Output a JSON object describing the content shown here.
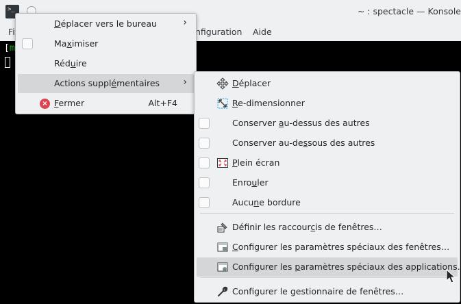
{
  "window": {
    "title": "~ : spectacle — Konsole",
    "menubar": [
      "Fi",
      "nfiguration",
      "Aide"
    ]
  },
  "terminal": {
    "prompt_bracket": "[",
    "prompt_green": "m"
  },
  "window_menu": {
    "items": [
      {
        "label_pre": "",
        "ul": "D",
        "label_post": "éplacer vers le bureau",
        "submenu": true
      },
      {
        "label_pre": "Ma",
        "ul": "x",
        "label_post": "imiser",
        "checkbox": true
      },
      {
        "label_pre": "Réd",
        "ul": "u",
        "label_post": "ire"
      },
      {
        "label_pre": "Actions suppl",
        "ul": "é",
        "label_post": "mentaires",
        "submenu": true,
        "highlighted": true
      },
      {
        "label_pre": "",
        "ul": "F",
        "label_post": "ermer",
        "shortcut": "Alt+F4",
        "icon": "close-icon"
      }
    ]
  },
  "actions_submenu": {
    "items": [
      {
        "label_pre": "",
        "ul": "D",
        "label_post": "éplacer",
        "icon": "move-icon"
      },
      {
        "label_pre": "",
        "ul": "R",
        "label_post": "e-dimensionner",
        "icon": "resize-icon"
      },
      {
        "label_pre": "Conserver ",
        "ul": "a",
        "label_post": "u-dessus des autres",
        "checkbox": true
      },
      {
        "label_pre": "Conserver au-de",
        "ul": "s",
        "label_post": "sous des autres",
        "checkbox": true
      },
      {
        "label_pre": "",
        "ul": "P",
        "label_post": "lein écran",
        "checkbox": true,
        "icon": "fullscreen-icon"
      },
      {
        "label_pre": "Enro",
        "ul": "u",
        "label_post": "ler",
        "checkbox": true
      },
      {
        "label_pre": "Aucu",
        "ul": "n",
        "label_post": "e bordure",
        "checkbox": true
      },
      {
        "label_pre": "Définir les raccour",
        "ul": "c",
        "label_post": "is de fenêtres…",
        "icon": "shortcut-icon"
      },
      {
        "label_pre": "",
        "ul": "C",
        "label_post": "onfigurer les paramètres spéciaux des fenêtres…",
        "icon": "window-settings-icon"
      },
      {
        "label_pre": "Configurer les ",
        "ul": "p",
        "label_post": "aramètres spéciaux des applications…",
        "icon": "app-settings-icon",
        "highlighted": true
      },
      {
        "label_pre": "Conf",
        "ul": "i",
        "label_post": "gurer le gestionnaire de fenêtres…",
        "icon": "wrench-icon"
      }
    ]
  }
}
